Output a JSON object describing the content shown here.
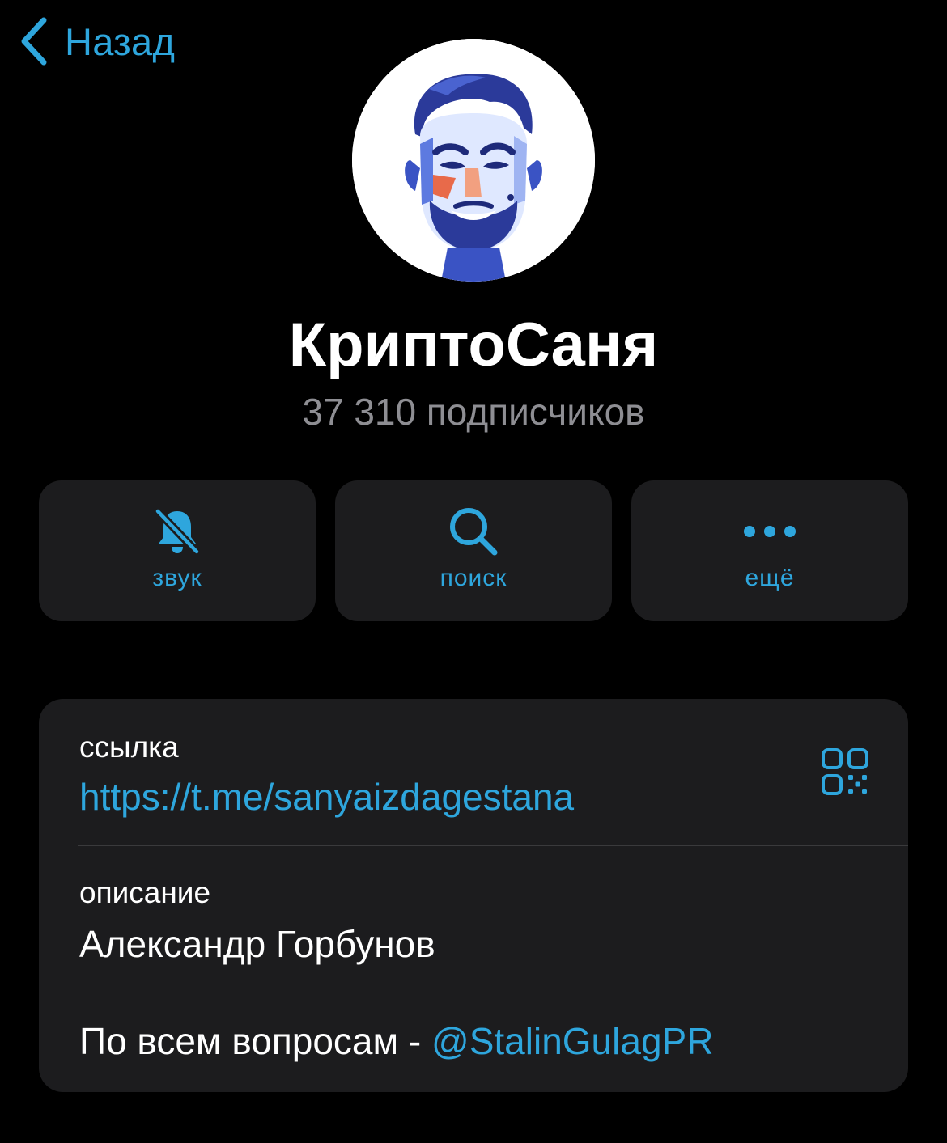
{
  "nav": {
    "back_label": "Назад"
  },
  "channel": {
    "name": "КриптоСаня",
    "subscribers": "37 310 подписчиков"
  },
  "actions": [
    {
      "label": "звук",
      "icon": "bell-muted-icon"
    },
    {
      "label": "поиск",
      "icon": "search-icon"
    },
    {
      "label": "ещё",
      "icon": "more-dots-icon"
    }
  ],
  "info": {
    "link_label": "ссылка",
    "link_value": "https://t.me/sanyaizdagestana",
    "description_label": "описание",
    "description_line1": "Александр Горбунов",
    "description_line2_prefix": "По всем вопросам - ",
    "description_mention": "@StalinGulagPR",
    "qr_icon": "qr-code-icon"
  },
  "colors": {
    "accent": "#2ea6dd",
    "background": "#000000",
    "card": "#1c1c1e",
    "secondary_text": "#8e8e93",
    "avatar_blue": "#2b3a9a",
    "avatar_orange": "#e86a4a"
  }
}
